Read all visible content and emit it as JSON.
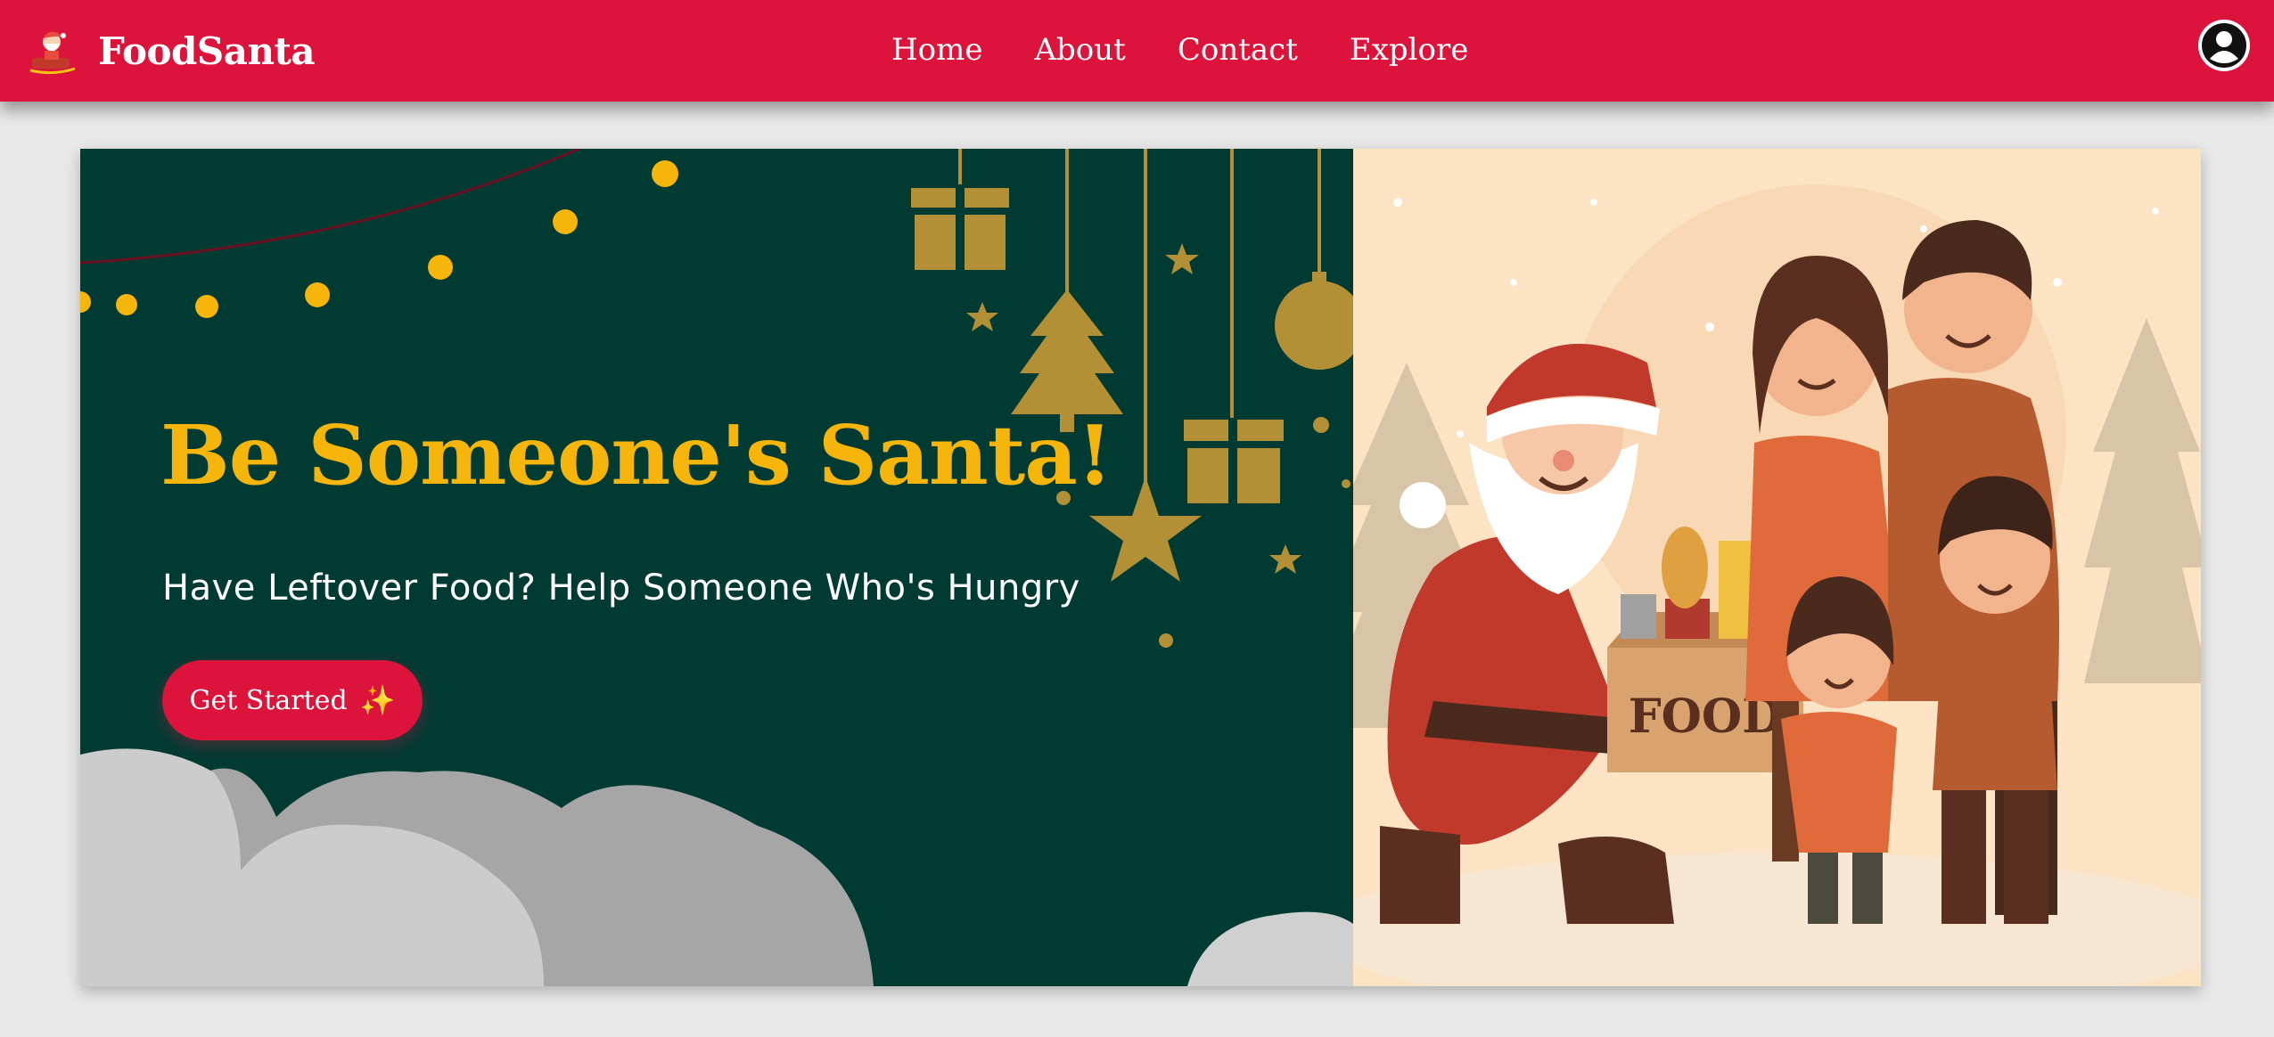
{
  "brand": {
    "name": "FoodSanta",
    "logo_icon": "santa-sleigh-icon"
  },
  "nav": {
    "links": [
      {
        "label": "Home"
      },
      {
        "label": "About"
      },
      {
        "label": "Contact"
      },
      {
        "label": "Explore"
      }
    ],
    "profile_icon": "user-circle-icon"
  },
  "hero": {
    "title": "Be Someone's Santa!",
    "subtitle": "Have Leftover Food? Help Someone Who's Hungry",
    "cta_label": "Get Started",
    "cta_icon": "✨",
    "illustration": {
      "box_label": "FOOD"
    }
  },
  "colors": {
    "primary_red": "#dc143c",
    "hero_green": "#003b33",
    "title_gold": "#f5b50a",
    "ornament_gold": "#b38f35",
    "illustration_bg": "#fbe3c4"
  }
}
